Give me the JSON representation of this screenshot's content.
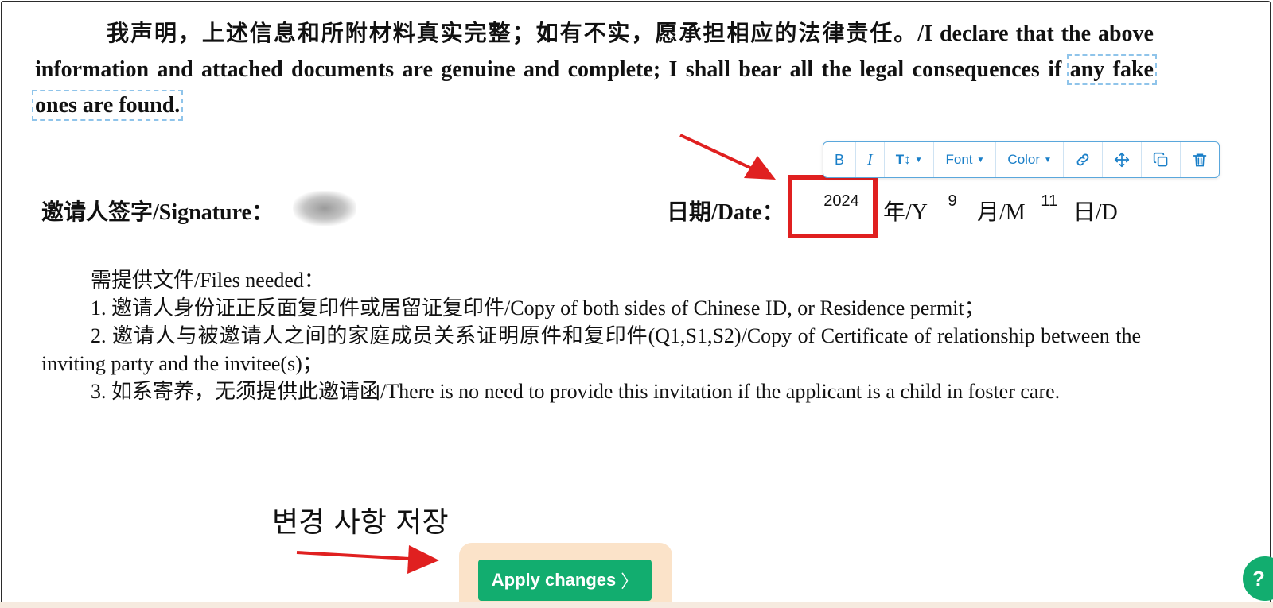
{
  "declaration": {
    "line": "我声明，上述信息和所附材料真实完整；如有不实，愿承担相应的法律责任。/I declare that the above information and attached documents are genuine and complete; I shall bear all the legal consequences if ",
    "selected": "any fake ones are found."
  },
  "signature": {
    "label": "邀请人签字/Signature："
  },
  "date": {
    "label": "日期/Date：",
    "year_value": "2024",
    "year_suffix": "年/Y",
    "month_value": "9",
    "month_suffix": "月/M",
    "day_value": "11",
    "day_suffix": "日/D"
  },
  "toolbar": {
    "bold": "B",
    "italic": "I",
    "size": "T↕",
    "font": "Font",
    "color": "Color"
  },
  "files": {
    "title": "需提供文件/Files needed：",
    "items": [
      "1. 邀请人身份证正反面复印件或居留证复印件/Copy of both sides of Chinese ID, or Residence permit；",
      "2. 邀请人与被邀请人之间的家庭成员关系证明原件和复印件(Q1,S1,S2)/Copy of Certificate of relationship between the inviting party and the invitee(s)；",
      "3. 如系寄养，无须提供此邀请函/There is no need to provide this invitation if the applicant is a child in foster care."
    ]
  },
  "annotation": {
    "korean": "변경 사항 저장"
  },
  "apply": {
    "label": "Apply changes"
  },
  "help": {
    "label": "?"
  },
  "colors": {
    "accent_green": "#12ad6f",
    "arrow_red": "#e02020",
    "toolbar_blue": "#1a7fc8"
  }
}
